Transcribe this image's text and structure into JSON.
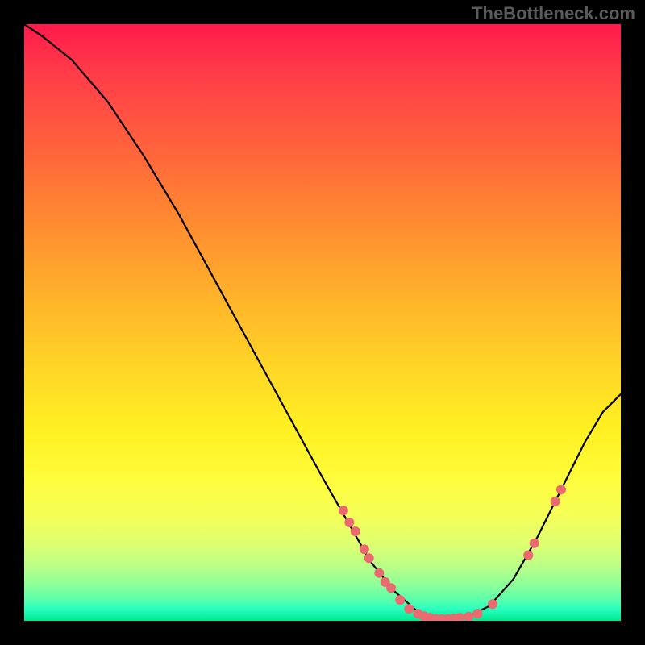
{
  "watermark": "TheBottleneck.com",
  "chart_data": {
    "type": "line",
    "title": "",
    "xlabel": "",
    "ylabel": "",
    "xlim": [
      0,
      100
    ],
    "ylim": [
      0,
      100
    ],
    "curve": [
      {
        "x": 0.0,
        "y": 100.0
      },
      {
        "x": 3.0,
        "y": 98.0
      },
      {
        "x": 8.0,
        "y": 94.0
      },
      {
        "x": 14.0,
        "y": 87.0
      },
      {
        "x": 20.0,
        "y": 78.0
      },
      {
        "x": 26.0,
        "y": 68.0
      },
      {
        "x": 32.0,
        "y": 57.0
      },
      {
        "x": 38.0,
        "y": 46.0
      },
      {
        "x": 44.0,
        "y": 35.0
      },
      {
        "x": 50.0,
        "y": 24.0
      },
      {
        "x": 54.0,
        "y": 17.0
      },
      {
        "x": 58.0,
        "y": 10.0
      },
      {
        "x": 62.0,
        "y": 5.0
      },
      {
        "x": 66.0,
        "y": 1.5
      },
      {
        "x": 70.0,
        "y": 0.3
      },
      {
        "x": 74.0,
        "y": 0.5
      },
      {
        "x": 78.0,
        "y": 2.5
      },
      {
        "x": 82.0,
        "y": 7.0
      },
      {
        "x": 86.0,
        "y": 14.0
      },
      {
        "x": 90.0,
        "y": 22.0
      },
      {
        "x": 94.0,
        "y": 30.0
      },
      {
        "x": 97.0,
        "y": 35.0
      },
      {
        "x": 100.0,
        "y": 38.0
      }
    ],
    "scatter_points": [
      {
        "x": 53.5,
        "y": 18.5
      },
      {
        "x": 54.5,
        "y": 16.5
      },
      {
        "x": 55.5,
        "y": 15.0
      },
      {
        "x": 57.0,
        "y": 12.0
      },
      {
        "x": 57.8,
        "y": 10.5
      },
      {
        "x": 59.5,
        "y": 8.0
      },
      {
        "x": 60.5,
        "y": 6.5
      },
      {
        "x": 61.5,
        "y": 5.5
      },
      {
        "x": 63.0,
        "y": 3.5
      },
      {
        "x": 64.5,
        "y": 2.0
      },
      {
        "x": 66.0,
        "y": 1.2
      },
      {
        "x": 67.0,
        "y": 0.8
      },
      {
        "x": 68.0,
        "y": 0.5
      },
      {
        "x": 69.0,
        "y": 0.3
      },
      {
        "x": 70.0,
        "y": 0.3
      },
      {
        "x": 71.0,
        "y": 0.3
      },
      {
        "x": 72.0,
        "y": 0.4
      },
      {
        "x": 73.0,
        "y": 0.5
      },
      {
        "x": 74.5,
        "y": 0.7
      },
      {
        "x": 76.0,
        "y": 1.2
      },
      {
        "x": 78.5,
        "y": 2.8
      },
      {
        "x": 84.5,
        "y": 11.0
      },
      {
        "x": 85.5,
        "y": 13.0
      },
      {
        "x": 89.0,
        "y": 20.0
      },
      {
        "x": 90.0,
        "y": 22.0
      }
    ]
  }
}
